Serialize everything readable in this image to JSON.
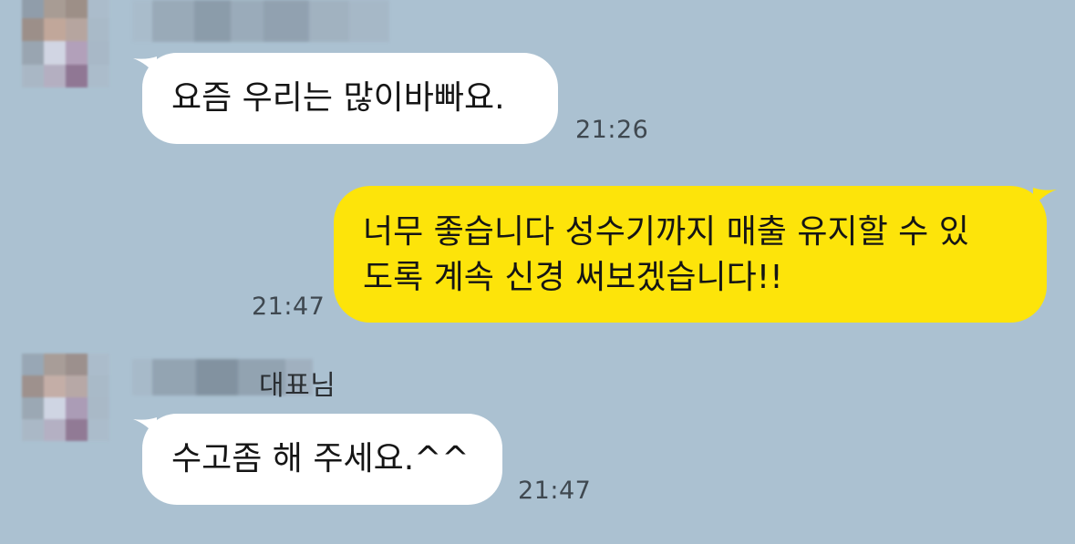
{
  "colors": {
    "background": "#abc1d1",
    "incoming_bubble": "#ffffff",
    "outgoing_bubble": "#fde40a"
  },
  "messages": [
    {
      "direction": "incoming",
      "text": "요즘 우리는 많이바빠요.",
      "time": "21:26"
    },
    {
      "direction": "outgoing",
      "line1": "너무 좋습니다 성수기까지 매출 유지할 수 있",
      "line2": "도록 계속 신경 써보겠습니다!!",
      "time": "21:47"
    },
    {
      "direction": "incoming",
      "sender_suffix": "대표님",
      "text": "수고좀 해 주세요.^^",
      "time": "21:47"
    }
  ]
}
